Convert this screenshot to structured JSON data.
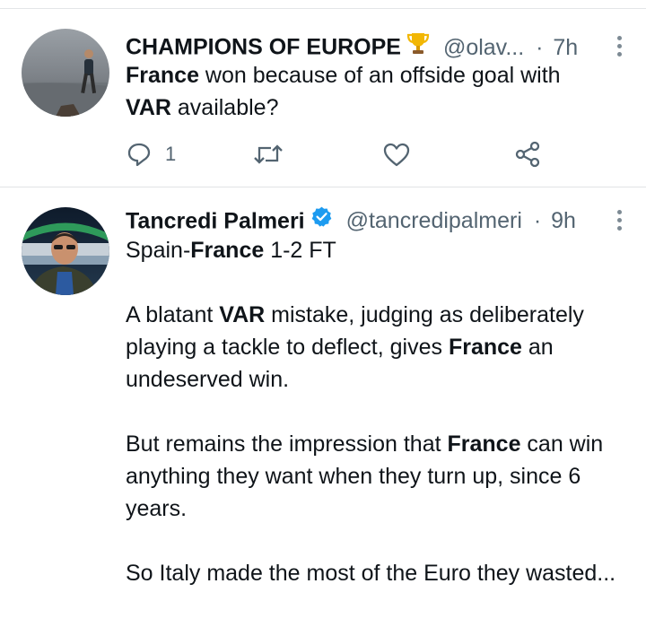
{
  "tweets": [
    {
      "name": "CHAMPIONS OF EUROPE",
      "name_emoji": "trophy-icon",
      "handle": "@olav...",
      "separator": "·",
      "time": "7h",
      "body": {
        "line1_bold": "France",
        "line1_rest": " won because of an offside goal with",
        "line2_bold": "VAR",
        "line2_rest": " available?"
      },
      "actions": {
        "reply_count": "1",
        "retweet_count": "",
        "like_count": ""
      }
    },
    {
      "name": "Tancredi Palmeri",
      "verified": true,
      "handle": "@tancredipalmeri",
      "separator": "·",
      "time": "9h",
      "body": {
        "score_pre": "Spain-",
        "score_bold": "France",
        "score_post": " 1-2 FT",
        "p1_a": "A blatant ",
        "p1_bold1": "VAR",
        "p1_b": " mistake, judging as deliberately playing a tackle to deflect, gives ",
        "p1_bold2": "France",
        "p1_c": " an undeserved win.",
        "p2_a": "But remains the impression that ",
        "p2_bold": "France",
        "p2_b": " can win anything they want when they turn up, since 6 years.",
        "p3": "So Italy made the most of the Euro they wasted..."
      }
    }
  ],
  "colors": {
    "text": "#0f1419",
    "secondary": "#536471",
    "verified": "#1d9bf0",
    "divider": "#e1e4e6"
  }
}
